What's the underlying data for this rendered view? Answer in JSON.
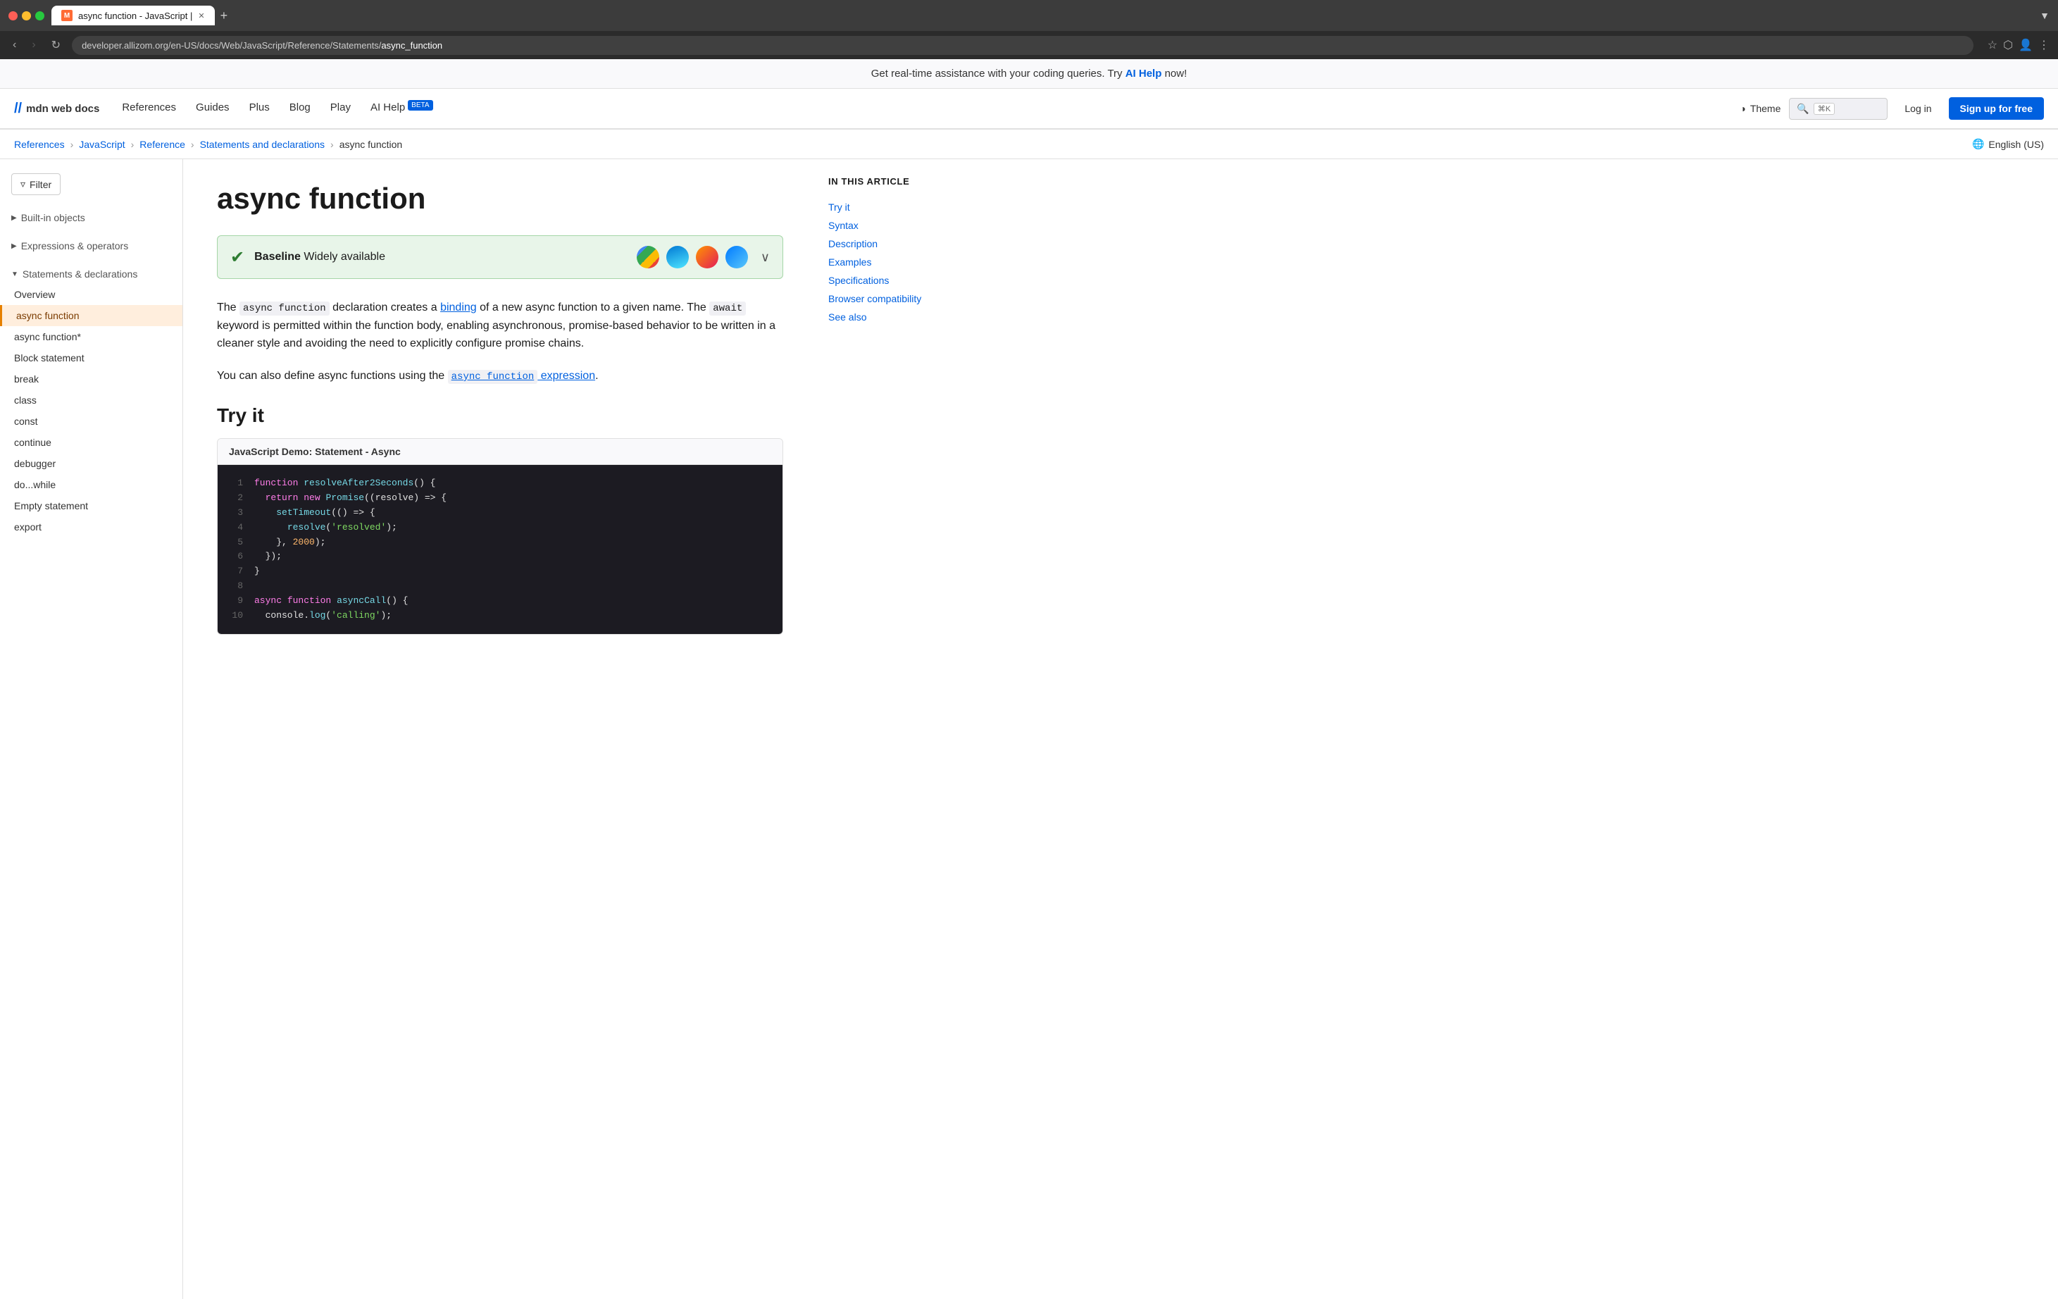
{
  "browser": {
    "tab_title": "async function - JavaScript |",
    "url_prefix": "developer.allizom.org/en-US/docs/Web/JavaScript/Reference/Statements/",
    "url_page": "async_function"
  },
  "banner": {
    "text": "Get real-time assistance with your coding queries. Try ",
    "link_text": "AI Help",
    "text_suffix": " now!"
  },
  "nav": {
    "logo_symbol": "//",
    "logo_text": "mdn web docs",
    "links": [
      {
        "label": "References"
      },
      {
        "label": "Guides"
      },
      {
        "label": "Plus"
      },
      {
        "label": "Blog"
      },
      {
        "label": "Play"
      },
      {
        "label": "AI Help",
        "badge": "BETA"
      }
    ],
    "theme_label": "Theme",
    "search_placeholder": "Search",
    "search_shortcut": "⌘K",
    "login_label": "Log in",
    "signup_label": "Sign up for free"
  },
  "breadcrumb": {
    "items": [
      {
        "label": "References",
        "link": true
      },
      {
        "label": "JavaScript",
        "link": true
      },
      {
        "label": "Reference",
        "link": true
      },
      {
        "label": "Statements and declarations",
        "link": true
      },
      {
        "label": "async function",
        "link": false
      }
    ],
    "lang_label": "English (US)"
  },
  "sidebar": {
    "filter_label": "Filter",
    "sections": [
      {
        "title": "Built-in objects",
        "expanded": false
      },
      {
        "title": "Expressions & operators",
        "expanded": false
      },
      {
        "title": "Statements & declarations",
        "expanded": true,
        "items": [
          {
            "label": "Overview",
            "active": false
          },
          {
            "label": "async function",
            "active": true
          },
          {
            "label": "async function*",
            "active": false
          },
          {
            "label": "Block statement",
            "active": false
          },
          {
            "label": "break",
            "active": false
          },
          {
            "label": "class",
            "active": false
          },
          {
            "label": "const",
            "active": false
          },
          {
            "label": "continue",
            "active": false
          },
          {
            "label": "debugger",
            "active": false
          },
          {
            "label": "do...while",
            "active": false
          },
          {
            "label": "Empty statement",
            "active": false
          },
          {
            "label": "export",
            "active": false
          }
        ]
      }
    ]
  },
  "article": {
    "title": "async function",
    "baseline": {
      "icon": "✓",
      "label": "Baseline",
      "description": "Widely available"
    },
    "intro_parts": [
      {
        "type": "text",
        "value": "The "
      },
      {
        "type": "code",
        "value": "async function"
      },
      {
        "type": "text",
        "value": " declaration creates a "
      },
      {
        "type": "link",
        "value": "binding"
      },
      {
        "type": "text",
        "value": " of a new async function to a given name. The "
      },
      {
        "type": "code",
        "value": "await"
      },
      {
        "type": "text",
        "value": " keyword is permitted within the function body, enabling asynchronous, promise-based behavior to be written in a cleaner style and avoiding the need to explicitly configure promise chains."
      }
    ],
    "second_para": "You can also define async functions using the ",
    "second_para_link": "async function expression",
    "second_para_end": ".",
    "try_it_heading": "Try it",
    "code_demo": {
      "header": "JavaScript Demo: Statement - Async",
      "lines": [
        {
          "num": "1",
          "code": "function resolveAfter2Seconds() {"
        },
        {
          "num": "2",
          "code": "  return new Promise((resolve) => {"
        },
        {
          "num": "3",
          "code": "    setTimeout(() => {"
        },
        {
          "num": "4",
          "code": "      resolve('resolved');"
        },
        {
          "num": "5",
          "code": "    }, 2000);"
        },
        {
          "num": "6",
          "code": "  });"
        },
        {
          "num": "7",
          "code": "}"
        },
        {
          "num": "8",
          "code": ""
        },
        {
          "num": "9",
          "code": "async function asyncCall() {"
        },
        {
          "num": "10",
          "code": "  console.log('calling');"
        }
      ]
    }
  },
  "toc": {
    "title": "In this article",
    "items": [
      {
        "label": "Try it"
      },
      {
        "label": "Syntax"
      },
      {
        "label": "Description"
      },
      {
        "label": "Examples"
      },
      {
        "label": "Specifications"
      },
      {
        "label": "Browser compatibility"
      },
      {
        "label": "See also"
      }
    ]
  }
}
